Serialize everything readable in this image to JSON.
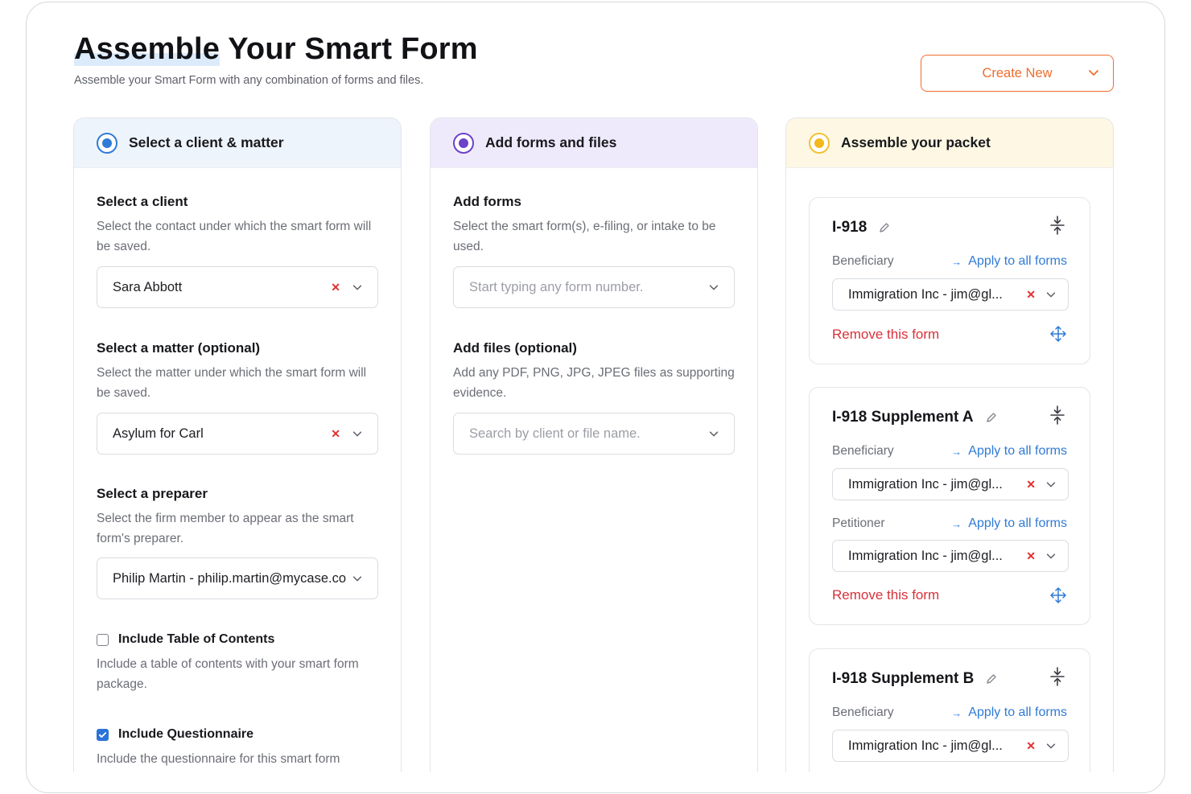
{
  "header": {
    "title_hl": "Assemble",
    "title_rest": " Your Smart Form",
    "subtitle": "Assemble your Smart Form with any combination of forms and files.",
    "create_new": "Create New"
  },
  "colors": {
    "accent_orange": "#ef6c2c",
    "step1": "#2f7bd6",
    "step2": "#6c42c7",
    "step3": "#f3b81a",
    "link": "#2f7bd6",
    "danger": "#d8313a"
  },
  "col1": {
    "heading": "Select a client & matter",
    "client": {
      "title": "Select a client",
      "desc": "Select the contact under which the smart form will be saved.",
      "value": "Sara Abbott"
    },
    "matter": {
      "title": "Select a matter (optional)",
      "desc": "Select the matter under which the smart form will be saved.",
      "value": "Asylum for Carl"
    },
    "preparer": {
      "title": "Select a preparer",
      "desc": "Select the firm member to appear as the smart form's preparer.",
      "value": "Philip Martin - philip.martin@mycase.com"
    },
    "toc": {
      "label": "Include Table of Contents",
      "desc": "Include a table of contents with your smart form package.",
      "checked": false
    },
    "questionnaire": {
      "label": "Include Questionnaire",
      "desc": "Include the questionnaire for this smart form",
      "checked": true
    }
  },
  "col2": {
    "heading": "Add forms and files",
    "forms": {
      "title": "Add forms",
      "desc": "Select the smart form(s), e-filing, or intake to be used.",
      "placeholder": "Start typing any form number."
    },
    "files": {
      "title": "Add files (optional)",
      "desc": "Add any PDF, PNG, JPG, JPEG files as supporting evidence.",
      "placeholder": "Search by client or file name."
    }
  },
  "col3": {
    "heading": "Assemble your packet",
    "apply_label": "Apply to all forms",
    "remove_label": "Remove this form",
    "cards": [
      {
        "title": "I-918",
        "roles": [
          {
            "role": "Beneficiary",
            "value": "Immigration Inc - jim@gl..."
          }
        ]
      },
      {
        "title": "I-918 Supplement A",
        "roles": [
          {
            "role": "Beneficiary",
            "value": "Immigration Inc - jim@gl..."
          },
          {
            "role": "Petitioner",
            "value": "Immigration Inc - jim@gl..."
          }
        ]
      },
      {
        "title": "I-918 Supplement B",
        "roles": [
          {
            "role": "Beneficiary",
            "value": "Immigration Inc - jim@gl..."
          }
        ]
      }
    ]
  }
}
